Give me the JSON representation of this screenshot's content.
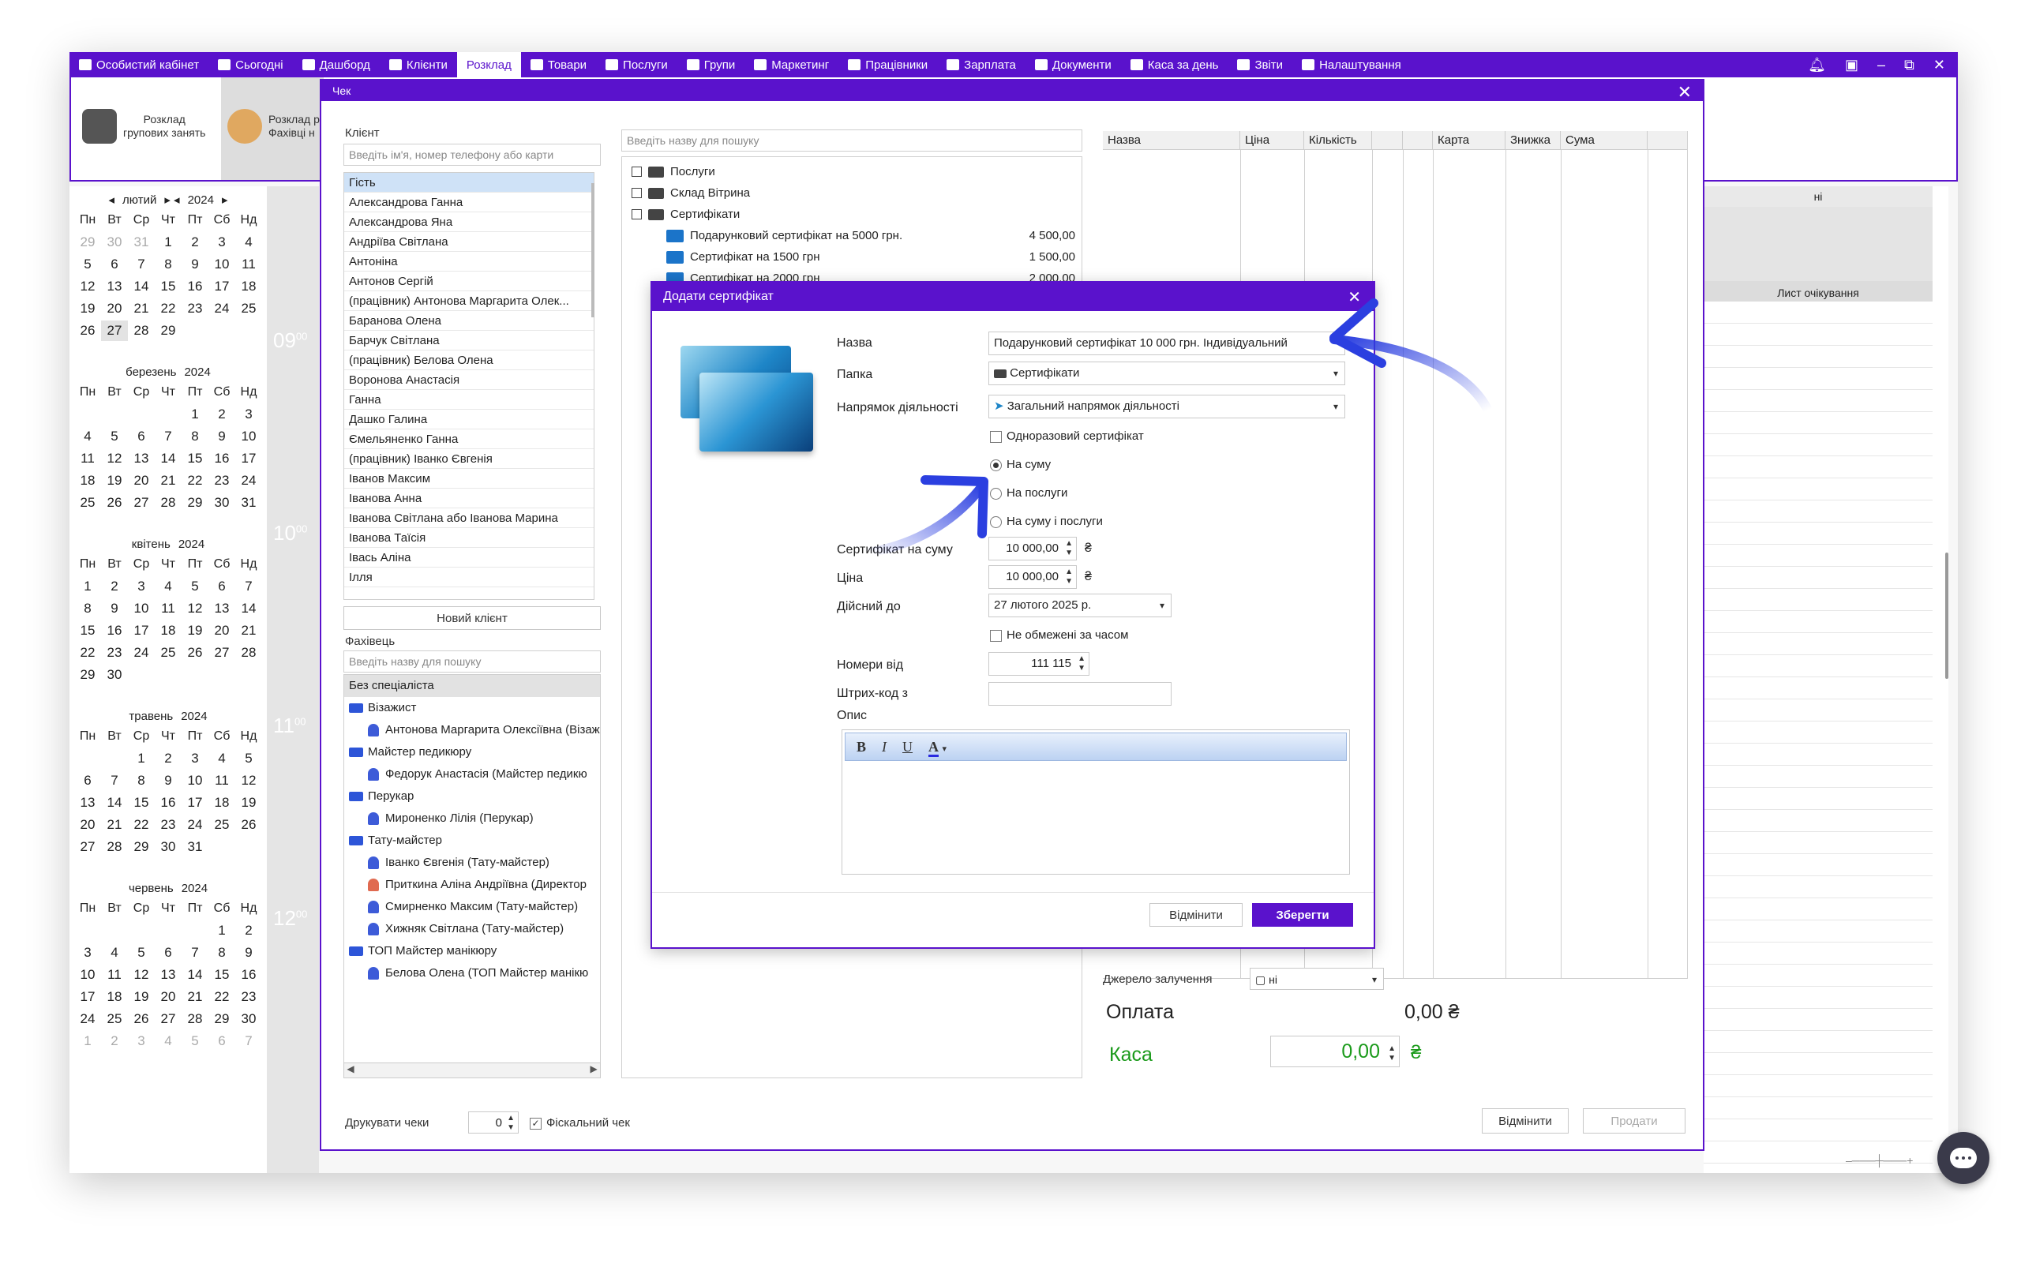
{
  "menu": [
    {
      "label": "Особистий кабінет",
      "icon": "cash-register-icon"
    },
    {
      "label": "Сьогодні",
      "icon": "clock-icon"
    },
    {
      "label": "Дашборд",
      "icon": "pulse-icon"
    },
    {
      "label": "Клієнти",
      "icon": "user-circle-icon"
    },
    {
      "label": "Розклад",
      "icon": "",
      "active": true
    },
    {
      "label": "Товари",
      "icon": "box-icon"
    },
    {
      "label": "Послуги",
      "icon": "lightning-icon"
    },
    {
      "label": "Групи",
      "icon": "group-icon"
    },
    {
      "label": "Маркетинг",
      "icon": "megaphone-icon"
    },
    {
      "label": "Працівники",
      "icon": "person-icon"
    },
    {
      "label": "Зарплата",
      "icon": "money-icon"
    },
    {
      "label": "Документи",
      "icon": "document-icon"
    },
    {
      "label": "Каса за день",
      "icon": "calculator-icon"
    },
    {
      "label": "Звіти",
      "icon": "bar-chart-icon"
    },
    {
      "label": "Налаштування",
      "icon": "gear-icon"
    }
  ],
  "toolbar": {
    "group_schedule": "Розклад\nгрупових занять",
    "spec_schedule": "Розклад р\nФахівці н"
  },
  "calendar": {
    "year": "2024",
    "weekdays": [
      "Пн",
      "Вт",
      "Ср",
      "Чт",
      "Пт",
      "Сб",
      "Нд"
    ],
    "months": [
      {
        "name": "лютий",
        "days": [
          "29",
          "30",
          "31",
          "1",
          "2",
          "3",
          "4",
          "5",
          "6",
          "7",
          "8",
          "9",
          "10",
          "11",
          "12",
          "13",
          "14",
          "15",
          "16",
          "17",
          "18",
          "19",
          "20",
          "21",
          "22",
          "23",
          "24",
          "25",
          "26",
          "27",
          "28",
          "29"
        ],
        "gray_lead": 3,
        "selected": "27"
      },
      {
        "name": "березень",
        "days": [
          "",
          "",
          "",
          "",
          "1",
          "2",
          "3",
          "4",
          "5",
          "6",
          "7",
          "8",
          "9",
          "10",
          "11",
          "12",
          "13",
          "14",
          "15",
          "16",
          "17",
          "18",
          "19",
          "20",
          "21",
          "22",
          "23",
          "24",
          "25",
          "26",
          "27",
          "28",
          "29",
          "30",
          "31"
        ],
        "gray_lead": 0
      },
      {
        "name": "квітень",
        "days": [
          "1",
          "2",
          "3",
          "4",
          "5",
          "6",
          "7",
          "8",
          "9",
          "10",
          "11",
          "12",
          "13",
          "14",
          "15",
          "16",
          "17",
          "18",
          "19",
          "20",
          "21",
          "22",
          "23",
          "24",
          "25",
          "26",
          "27",
          "28",
          "29",
          "30"
        ],
        "gray_lead": 0
      },
      {
        "name": "травень",
        "days": [
          "",
          "",
          "1",
          "2",
          "3",
          "4",
          "5",
          "6",
          "7",
          "8",
          "9",
          "10",
          "11",
          "12",
          "13",
          "14",
          "15",
          "16",
          "17",
          "18",
          "19",
          "20",
          "21",
          "22",
          "23",
          "24",
          "25",
          "26",
          "27",
          "28",
          "29",
          "30",
          "31"
        ],
        "gray_lead": 0
      },
      {
        "name": "червень",
        "days": [
          "",
          "",
          "",
          "",
          "",
          "1",
          "2",
          "3",
          "4",
          "5",
          "6",
          "7",
          "8",
          "9",
          "10",
          "11",
          "12",
          "13",
          "14",
          "15",
          "16",
          "17",
          "18",
          "19",
          "20",
          "21",
          "22",
          "23",
          "24",
          "25",
          "26",
          "27",
          "28",
          "29",
          "30",
          "1",
          "2",
          "3",
          "4",
          "5",
          "6",
          "7"
        ],
        "gray_lead": 0,
        "gray_tail": 7
      }
    ]
  },
  "times": [
    "09",
    "10",
    "11",
    "12"
  ],
  "times_sup": "00",
  "right_panel": {
    "col_header": "ні",
    "wait_list": "Лист очікування"
  },
  "chek": {
    "title": "Чек",
    "client_label": "Клієнт",
    "client_placeholder": "Введіть ім'я, номер телефону або карти",
    "clients": [
      "Гість",
      "Александрова Ганна",
      "Александрова Яна",
      "Андріїва Світлана",
      "Антоніна",
      "Антонов Сергій",
      "(працівник) Антонова Маргарита Олек...",
      "Баранова Олена",
      "Барчук Світлана",
      "(працівник) Белова Олена",
      "Воронова Анастасія",
      "Ганна",
      "Дашко Галина",
      "Ємельяненко Ганна",
      "(працівник) Іванко Євгенія",
      "Іванов Максим",
      "Іванова Анна",
      "Іванова Світлана або Іванова Марина",
      "Іванова Таїсія",
      "Івась Аліна",
      "Ілля"
    ],
    "new_client": "Новий клієнт",
    "specialist_label": "Фахівець",
    "specialist_placeholder": "Введіть назву для пошуку",
    "specialists": [
      {
        "type": "header",
        "text": "Без спеціаліста"
      },
      {
        "type": "folder",
        "text": "Візажист"
      },
      {
        "type": "person",
        "text": "Антонова Маргарита Олексіївна (Візаж"
      },
      {
        "type": "folder",
        "text": "Майстер педикюру"
      },
      {
        "type": "person",
        "text": "Федорук Анастасія (Майстер педикю"
      },
      {
        "type": "folder",
        "text": "Перукар"
      },
      {
        "type": "person",
        "text": "Мироненко Лілія (Перукар)"
      },
      {
        "type": "folder",
        "text": "Тату-майстер"
      },
      {
        "type": "person",
        "text": "Іванко Євгенія (Тату-майстер)"
      },
      {
        "type": "person",
        "text": "Приткина Аліна Андріївна (Директор"
      },
      {
        "type": "person",
        "text": "Смирненко Максим (Тату-майстер)"
      },
      {
        "type": "person",
        "text": "Хижняк Світлана (Тату-майстер)"
      },
      {
        "type": "folder",
        "text": "ТОП Майстер манікюру"
      },
      {
        "type": "person",
        "text": "Белова Олена (ТОП Майстер манікю"
      }
    ],
    "goods_placeholder": "Введіть назву для пошуку",
    "tree": [
      {
        "text": "Послуги",
        "kind": "folder"
      },
      {
        "text": "Склад Вітрина",
        "kind": "folder"
      },
      {
        "text": "Сертифікати",
        "kind": "folder"
      },
      {
        "text": "Подарунковий сертифікат на 5000 грн.",
        "kind": "cert",
        "price": "4 500,00"
      },
      {
        "text": "Сертифікат на 1500 грн",
        "kind": "cert",
        "price": "1 500,00"
      },
      {
        "text": "Сертифікат на 2000 грн",
        "kind": "cert",
        "price": "2 000,00"
      }
    ],
    "table_cols": [
      "Назва",
      "Ціна",
      "Кількість",
      "",
      "",
      "Карта",
      "Знижка",
      "Сума"
    ],
    "source_label": "Джерело залучення",
    "source_value": "ні",
    "payment_label": "Оплата",
    "payment_value": "0,00 ₴",
    "cash_label": "Каса",
    "cash_value": "0,00",
    "currency": "₴",
    "print_label": "Друкувати чеки",
    "print_count": "0",
    "fiscal_label": "Фіскальний чек",
    "cancel": "Відмінити",
    "sell": "Продати"
  },
  "cert_dialog": {
    "title": "Додати сертифікат",
    "name_label": "Назва",
    "name_value": "Подарунковий сертифікат 10 000 грн. Індивідуальний",
    "folder_label": "Папка",
    "folder_value": "Сертифікати",
    "direction_label": "Напрямок діяльності",
    "direction_value": "Загальний напрямок діяльності",
    "one_time": "Одноразовий сертифікат",
    "radio_sum": "На суму",
    "radio_services": "На послуги",
    "radio_both": "На суму і послуги",
    "amount_label": "Сертифікат на суму",
    "amount_value": "10 000,00",
    "price_label": "Ціна",
    "price_value": "10 000,00",
    "currency": "₴",
    "valid_label": "Дійсний до",
    "valid_value": "27 лютого  2025 р.",
    "unlimited": "Не обмежені за часом",
    "numbers_label": "Номери від",
    "numbers_value": "111 115",
    "barcode_label": "Штрих-код з",
    "desc_label": "Опис",
    "fmt_bold": "B",
    "fmt_italic": "I",
    "fmt_underline": "U",
    "fmt_color": "A",
    "cancel": "Відмінити",
    "save": "Зберегти"
  },
  "colors": {
    "brand": "#5a12cc",
    "arrow": "#2b3fe0",
    "cash_green": "#1a9a1a"
  }
}
